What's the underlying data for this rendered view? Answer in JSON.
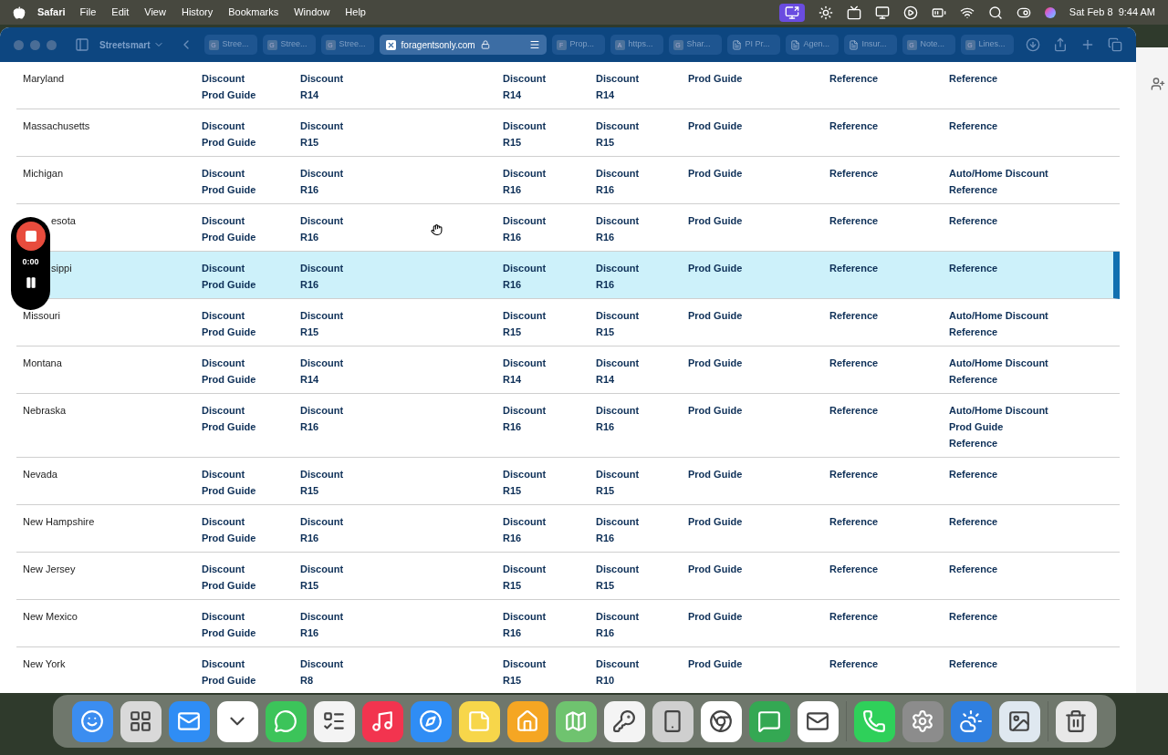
{
  "menu_bar": {
    "app": "Safari",
    "items": [
      "File",
      "Edit",
      "View",
      "History",
      "Bookmarks",
      "Window",
      "Help"
    ],
    "clock": "Sat Feb 8  9:44 AM"
  },
  "browser": {
    "tab_group": "Streetsmart",
    "tabs": [
      {
        "label": "Stree...",
        "favicon": "G",
        "selected": false
      },
      {
        "label": "Stree...",
        "favicon": "G",
        "selected": false
      },
      {
        "label": "Stree...",
        "favicon": "G",
        "selected": false
      },
      {
        "label": "foragentsonly.com",
        "selected": true
      },
      {
        "label": "Prop...",
        "favicon": "F",
        "selected": false
      },
      {
        "label": "https...",
        "favicon": "A",
        "selected": false
      },
      {
        "label": "Shar...",
        "favicon": "G",
        "selected": false
      },
      {
        "label": "PI Pr...",
        "selected": false
      },
      {
        "label": "Agen...",
        "selected": false
      },
      {
        "label": "Insur...",
        "selected": false
      },
      {
        "label": "Note...",
        "favicon": "G",
        "selected": false
      },
      {
        "label": "Lines...",
        "favicon": "G",
        "selected": false
      }
    ]
  },
  "table": {
    "rows": [
      {
        "state": "Maryland",
        "selected": false,
        "cells": [
          [
            "Discount",
            "Prod Guide"
          ],
          [
            "Discount",
            "R14"
          ],
          [
            "Discount",
            "R14"
          ],
          [
            "Discount",
            "R14"
          ],
          [
            "Prod Guide"
          ],
          [
            "Reference"
          ],
          [
            "Reference"
          ]
        ]
      },
      {
        "state": "Massachusetts",
        "selected": false,
        "cells": [
          [
            "Discount",
            "Prod Guide"
          ],
          [
            "Discount",
            "R15"
          ],
          [
            "Discount",
            "R15"
          ],
          [
            "Discount",
            "R15"
          ],
          [
            "Prod Guide"
          ],
          [
            "Reference"
          ],
          [
            "Reference"
          ]
        ]
      },
      {
        "state": "Michigan",
        "selected": false,
        "cells": [
          [
            "Discount",
            "Prod Guide"
          ],
          [
            "Discount",
            "R16"
          ],
          [
            "Discount",
            "R16"
          ],
          [
            "Discount",
            "R16"
          ],
          [
            "Prod Guide"
          ],
          [
            "Reference"
          ],
          [
            "Auto/Home Discount",
            "Reference"
          ]
        ]
      },
      {
        "state": "esota",
        "covered": true,
        "selected": false,
        "cells": [
          [
            "Discount",
            "Prod Guide"
          ],
          [
            "Discount",
            "R16"
          ],
          [
            "Discount",
            "R16"
          ],
          [
            "Discount",
            "R16"
          ],
          [
            "Prod Guide"
          ],
          [
            "Reference"
          ],
          [
            "Reference"
          ]
        ]
      },
      {
        "state": "sippi",
        "covered": true,
        "selected": true,
        "cells": [
          [
            "Discount",
            "Prod Guide"
          ],
          [
            "Discount",
            "R16"
          ],
          [
            "Discount",
            "R16"
          ],
          [
            "Discount",
            "R16"
          ],
          [
            "Prod Guide"
          ],
          [
            "Reference"
          ],
          [
            "Reference"
          ]
        ]
      },
      {
        "state": "Missouri",
        "selected": false,
        "cells": [
          [
            "Discount",
            "Prod Guide"
          ],
          [
            "Discount",
            "R15"
          ],
          [
            "Discount",
            "R15"
          ],
          [
            "Discount",
            "R15"
          ],
          [
            "Prod Guide"
          ],
          [
            "Reference"
          ],
          [
            "Auto/Home Discount",
            "Reference"
          ]
        ]
      },
      {
        "state": "Montana",
        "selected": false,
        "cells": [
          [
            "Discount",
            "Prod Guide"
          ],
          [
            "Discount",
            "R14"
          ],
          [
            "Discount",
            "R14"
          ],
          [
            "Discount",
            "R14"
          ],
          [
            "Prod Guide"
          ],
          [
            "Reference"
          ],
          [
            "Auto/Home Discount",
            "Reference"
          ]
        ]
      },
      {
        "state": "Nebraska",
        "selected": false,
        "cells": [
          [
            "Discount",
            "Prod Guide"
          ],
          [
            "Discount",
            "R16"
          ],
          [
            "Discount",
            "R16"
          ],
          [
            "Discount",
            "R16"
          ],
          [
            "Prod Guide"
          ],
          [
            "Reference"
          ],
          [
            "Auto/Home Discount",
            "Prod Guide",
            "Reference"
          ]
        ]
      },
      {
        "state": "Nevada",
        "selected": false,
        "cells": [
          [
            "Discount",
            "Prod Guide"
          ],
          [
            "Discount",
            "R15"
          ],
          [
            "Discount",
            "R15"
          ],
          [
            "Discount",
            "R15"
          ],
          [
            "Prod Guide"
          ],
          [
            "Reference"
          ],
          [
            "Reference"
          ]
        ]
      },
      {
        "state": "New Hampshire",
        "selected": false,
        "cells": [
          [
            "Discount",
            "Prod Guide"
          ],
          [
            "Discount",
            "R16"
          ],
          [
            "Discount",
            "R16"
          ],
          [
            "Discount",
            "R16"
          ],
          [
            "Prod Guide"
          ],
          [
            "Reference"
          ],
          [
            "Reference"
          ]
        ]
      },
      {
        "state": "New Jersey",
        "selected": false,
        "cells": [
          [
            "Discount",
            "Prod Guide"
          ],
          [
            "Discount",
            "R15"
          ],
          [
            "Discount",
            "R15"
          ],
          [
            "Discount",
            "R15"
          ],
          [
            "Prod Guide"
          ],
          [
            "Reference"
          ],
          [
            "Reference"
          ]
        ]
      },
      {
        "state": "New Mexico",
        "selected": false,
        "cells": [
          [
            "Discount",
            "Prod Guide"
          ],
          [
            "Discount",
            "R16"
          ],
          [
            "Discount",
            "R16"
          ],
          [
            "Discount",
            "R16"
          ],
          [
            "Prod Guide"
          ],
          [
            "Reference"
          ],
          [
            "Reference"
          ]
        ]
      },
      {
        "state": "New York",
        "selected": false,
        "cells": [
          [
            "Discount",
            "Prod Guide"
          ],
          [
            "Discount",
            "R8"
          ],
          [
            "Discount",
            "R15"
          ],
          [
            "Discount",
            "R10"
          ],
          [
            "Prod Guide"
          ],
          [
            "Reference"
          ],
          [
            "Reference"
          ]
        ]
      }
    ]
  },
  "recorder": {
    "time": "0:00"
  }
}
